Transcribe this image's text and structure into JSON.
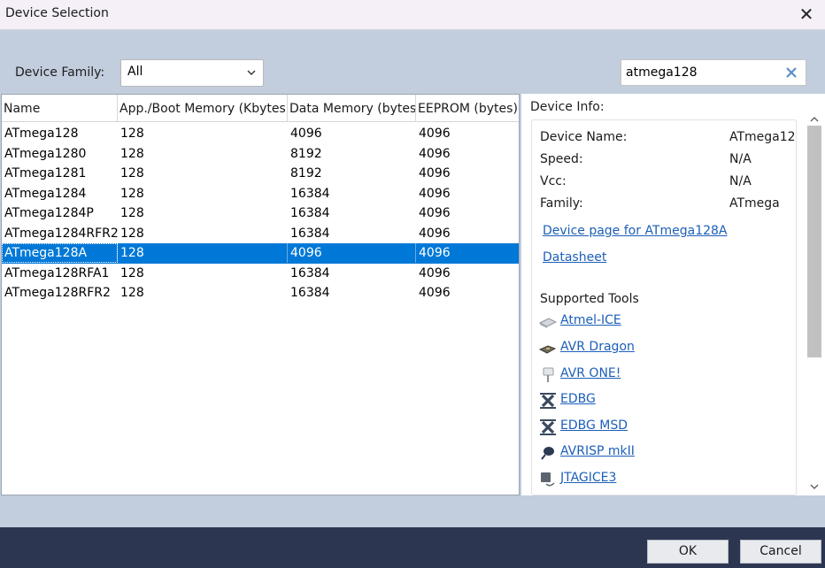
{
  "window": {
    "title": "Device Selection",
    "close_glyph": "✕"
  },
  "filter": {
    "family_label": "Device Family:",
    "family_value": "All",
    "search_value": "atmega128"
  },
  "table": {
    "columns": [
      "Name",
      "App./Boot Memory (Kbytes)",
      "Data Memory (bytes)",
      "EEPROM (bytes)"
    ],
    "rows": [
      [
        "ATmega128",
        "128",
        "4096",
        "4096"
      ],
      [
        "ATmega1280",
        "128",
        "8192",
        "4096"
      ],
      [
        "ATmega1281",
        "128",
        "8192",
        "4096"
      ],
      [
        "ATmega1284",
        "128",
        "16384",
        "4096"
      ],
      [
        "ATmega1284P",
        "128",
        "16384",
        "4096"
      ],
      [
        "ATmega1284RFR2",
        "128",
        "16384",
        "4096"
      ],
      [
        "ATmega128A",
        "128",
        "4096",
        "4096"
      ],
      [
        "ATmega128RFA1",
        "128",
        "16384",
        "4096"
      ],
      [
        "ATmega128RFR2",
        "128",
        "16384",
        "4096"
      ]
    ],
    "selected_index": 6
  },
  "info": {
    "label": "Device Info:",
    "fields": [
      {
        "key": "Device Name:",
        "value": "ATmega12"
      },
      {
        "key": "Speed:",
        "value": "N/A"
      },
      {
        "key": "Vcc:",
        "value": "N/A"
      },
      {
        "key": "Family:",
        "value": "ATmega"
      }
    ],
    "device_page_link": "Device page for ATmega128A",
    "datasheet_link": "Datasheet",
    "supported_tools_label": "Supported Tools",
    "tools": [
      {
        "name": "Atmel-ICE",
        "icon": "atmel-ice-icon"
      },
      {
        "name": "AVR Dragon",
        "icon": "avr-dragon-icon"
      },
      {
        "name": "AVR ONE!",
        "icon": "avr-one-icon"
      },
      {
        "name": "EDBG",
        "icon": "edbg-icon"
      },
      {
        "name": "EDBG MSD",
        "icon": "edbg-msd-icon"
      },
      {
        "name": "AVRISP mkII",
        "icon": "avrisp-mkii-icon"
      },
      {
        "name": "JTAGICE3",
        "icon": "jtagice3-icon"
      }
    ]
  },
  "buttons": {
    "ok": "OK",
    "cancel": "Cancel"
  },
  "colors": {
    "selection": "#0078d7",
    "link": "#1c5fb8",
    "footer": "#2c3650",
    "background": "#c2cddd",
    "search_clear": "#5b8fc9"
  }
}
